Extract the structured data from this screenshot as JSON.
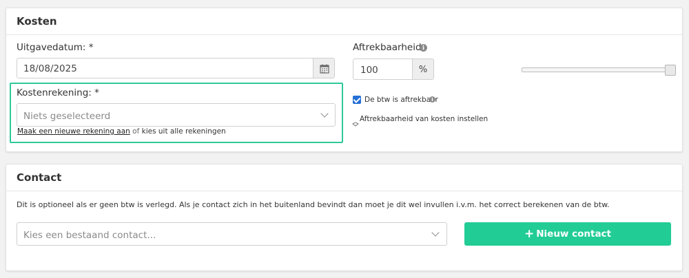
{
  "kosten": {
    "title": "Kosten",
    "date_label": "Uitgavedatum: *",
    "date_value": "18/08/2025",
    "account_label": "Kostenrekening: *",
    "account_placeholder": "Niets geselecteerd",
    "new_account_link": "Maak een nieuwe rekening aan",
    "or_text": "of",
    "choose_all_text": "kies uit alle rekeningen",
    "deductibility_label": "Aftrekbaarheid",
    "deductibility_value": "100",
    "deductibility_unit": "%",
    "deductibility_slider_fraction": 1.0,
    "vat_deductible_label": "De btw is aftrekbaar",
    "vat_deductible_checked": true,
    "set_deductibility_link": "Aftrekbaarheid van kosten instellen"
  },
  "contact": {
    "title": "Contact",
    "description": "Dit is optioneel als er geen btw is verlegd. Als je contact zich in het buitenland bevindt dan moet je dit wel invullen i.v.m. het correct berekenen van de btw.",
    "select_placeholder": "Kies een bestaand contact...",
    "new_contact_label": "Nieuw contact",
    "new_contact_icon": "+"
  },
  "colors": {
    "accent": "#22cc95",
    "highlight_border": "#2ec998",
    "checkbox": "#2470d6"
  }
}
